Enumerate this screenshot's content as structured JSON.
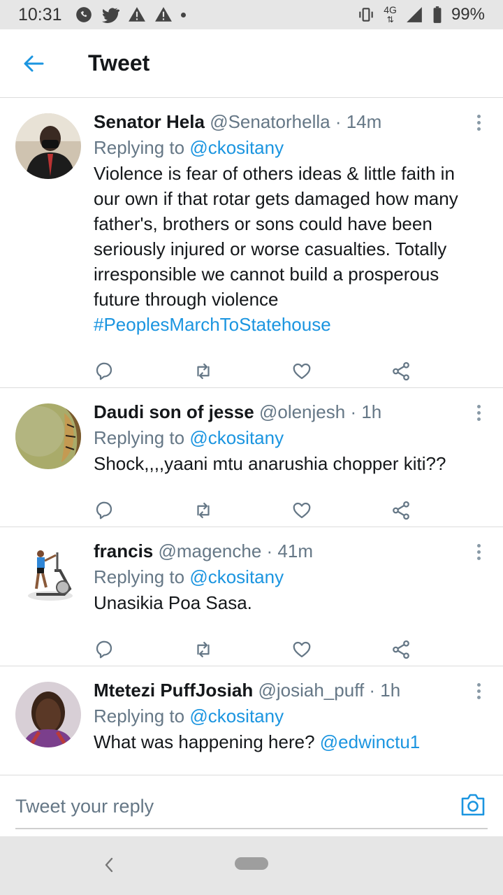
{
  "status_bar": {
    "time": "10:31",
    "network": "4G",
    "battery": "99%",
    "icons": [
      "whatsapp-icon",
      "twitter-icon",
      "warning-icon",
      "warning-icon",
      "dot"
    ]
  },
  "header": {
    "title": "Tweet",
    "back_icon": "arrow-left-icon"
  },
  "tweets": [
    {
      "name": "Senator Hela",
      "handle": "@Senatorhella",
      "time": "· 14m",
      "replying_prefix": "Replying to",
      "replying_to": "@ckositany",
      "text": "Violence is fear of others ideas & little faith in our own if that rotar gets damaged how many father's, brothers or sons could have been seriously injured or worse casualties. Totally irresponsible we cannot build a prosperous future through violence",
      "hashtag": "#PeoplesMarchToStatehouse"
    },
    {
      "name": "Daudi son of jesse",
      "handle": "@olenjesh",
      "time": "· 1h",
      "replying_prefix": "Replying to",
      "replying_to": "@ckositany",
      "text": "Shock,,,,yaani mtu anarushia chopper kiti??"
    },
    {
      "name": "francis",
      "handle": "@magenche",
      "time": "· 41m",
      "replying_prefix": "Replying to",
      "replying_to": "@ckositany",
      "text": "Unasikia Poa Sasa."
    },
    {
      "name": "Mtetezi PuffJosiah",
      "handle": "@josiah_puff",
      "time": "· 1h",
      "replying_prefix": "Replying to",
      "replying_to": "@ckositany",
      "text": "What was happening here?",
      "mention": "@edwinctu1"
    }
  ],
  "composer": {
    "placeholder": "Tweet your reply"
  },
  "colors": {
    "link": "#1b95e0",
    "muted": "#657786",
    "text": "#14171a",
    "icon": "#657786"
  }
}
